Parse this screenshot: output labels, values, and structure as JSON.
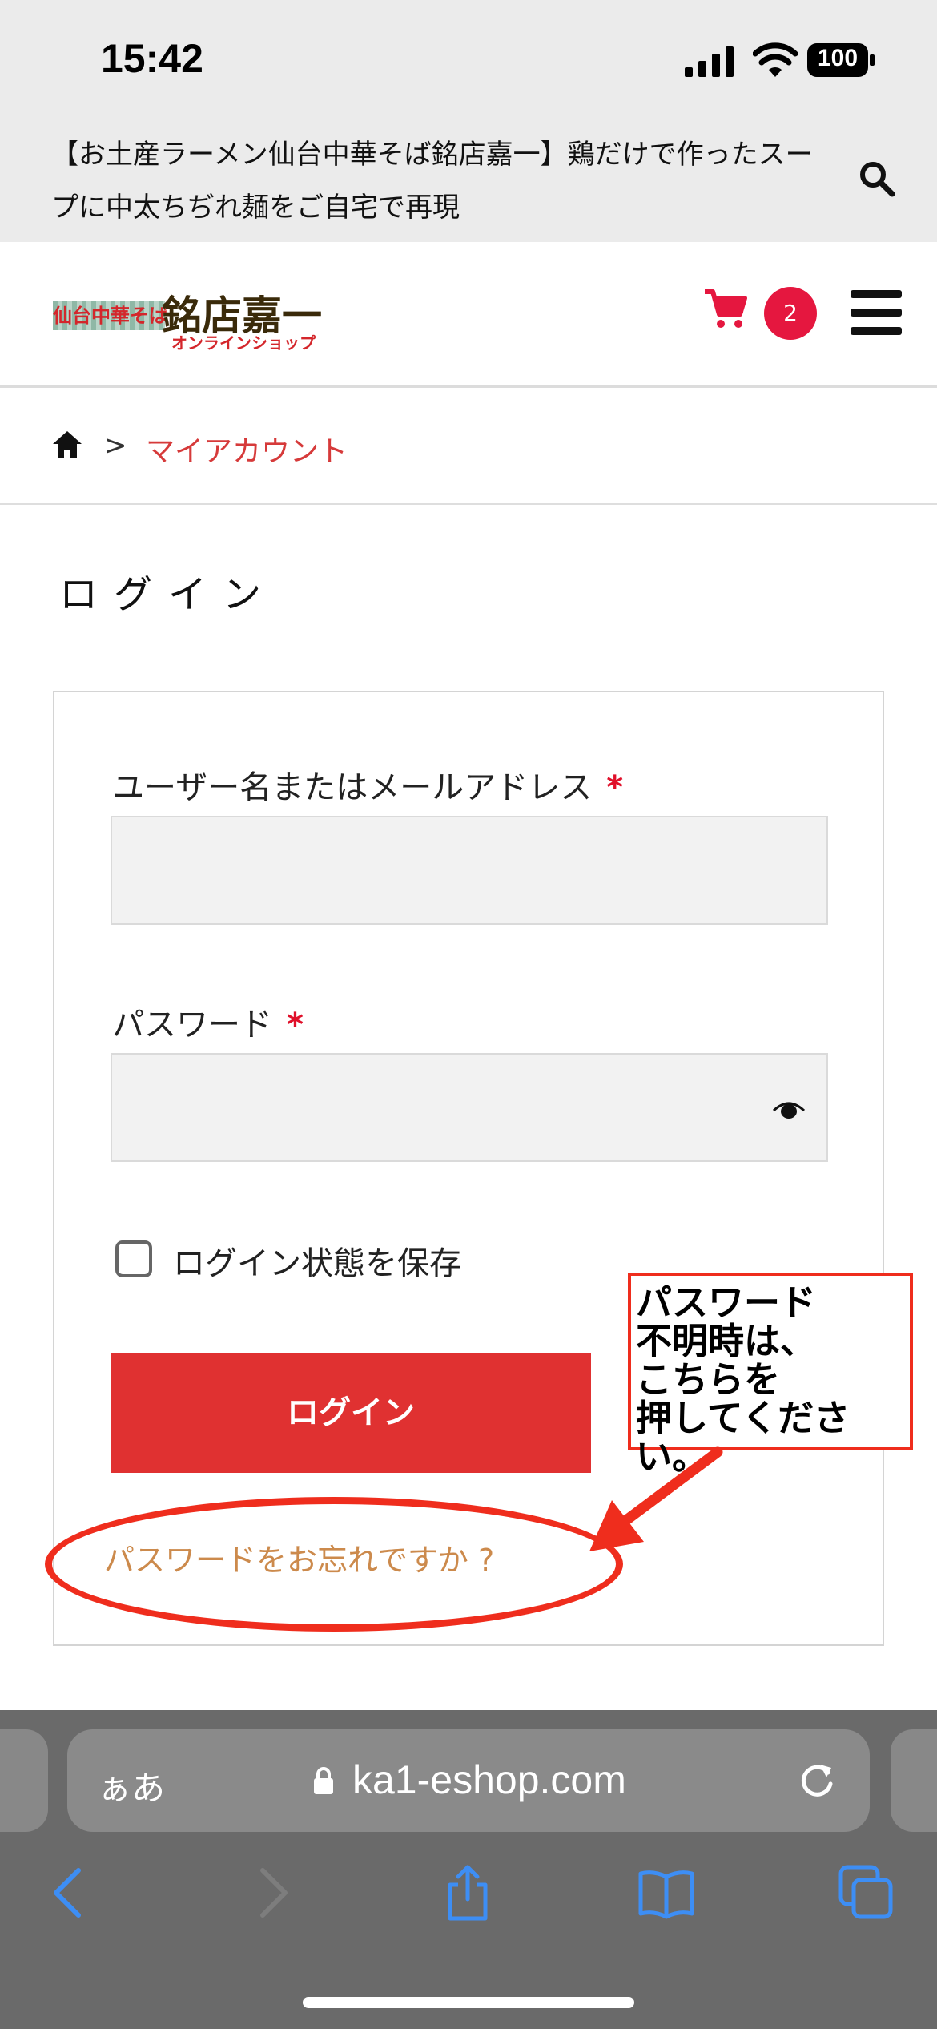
{
  "status_bar": {
    "time": "15:42",
    "battery": "100",
    "icons": [
      "signal-icon",
      "wifi-icon",
      "battery-icon"
    ]
  },
  "page_title": {
    "text": "【お土産ラーメン仙台中華そば銘店嘉一】鶏だけで作ったスープに中太ちぢれ麺をご自宅で再現",
    "search_icon": "search-icon"
  },
  "header": {
    "logo": {
      "line1": "仙台中華そば",
      "line2": "銘店嘉一",
      "line3": "オンラインショップ"
    },
    "cart_icon": "cart-icon",
    "cart_count": "2",
    "menu_icon": "hamburger-menu-icon",
    "colors": {
      "accent": "#e5173f"
    }
  },
  "breadcrumb": {
    "home_icon": "home-icon",
    "separator": ">",
    "current": "マイアカウント"
  },
  "login": {
    "heading": "ログイン",
    "username_label": "ユーザー名またはメールアドレス",
    "password_label": "パスワード",
    "required_mark": "*",
    "username_value": "",
    "password_value": "",
    "remember_label": "ログイン状態を保存",
    "remember_checked": false,
    "submit_label": "ログイン",
    "forgot_link": "パスワードをお忘れですか ?",
    "colors": {
      "button": "#e03131",
      "link": "#cc8a4c",
      "required": "#e0102a"
    }
  },
  "annotation": {
    "text": "パスワード\n不明時は、\nこちらを\n押してください。",
    "color": "#ef2d1d"
  },
  "browser": {
    "aa_label": "ぁあ",
    "url": "ka1-eshop.com",
    "toolbar_icons": [
      "back-icon",
      "forward-icon",
      "share-icon",
      "bookmarks-icon",
      "tabs-icon"
    ]
  }
}
